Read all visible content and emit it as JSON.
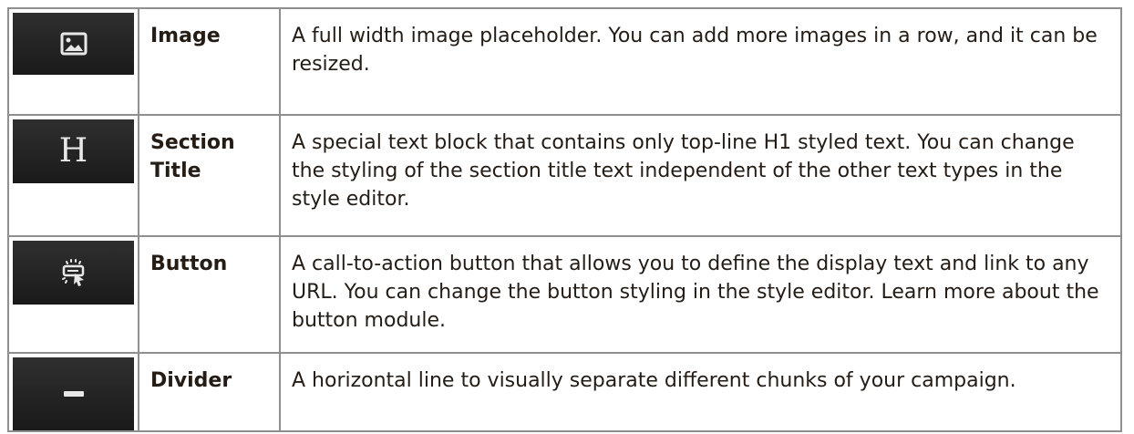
{
  "rows": [
    {
      "icon": "image-placeholder-icon",
      "name": "Image",
      "description": "A full width image placeholder. You can add more images in a row, and it can be resized."
    },
    {
      "icon": "heading-h-icon",
      "icon_glyph": "H",
      "name": "Section Title",
      "description": "A special text block that contains only top-line H1 styled text. You can change the styling of the section title text independent of the other text types in the style editor."
    },
    {
      "icon": "button-click-icon",
      "name": "Button",
      "description": "A call-to-action button that allows you to define the display text and link to any URL. You can change the button styling in the style editor. Learn more about the button module."
    },
    {
      "icon": "divider-line-icon",
      "name": "Divider",
      "description": "A horizontal line to visually separate different chunks of your campaign."
    }
  ],
  "colors": {
    "icon_background": "#1f1f1f",
    "icon_foreground": "#e8e8e8",
    "border": "#8f8f8f",
    "text": "#241c15"
  }
}
